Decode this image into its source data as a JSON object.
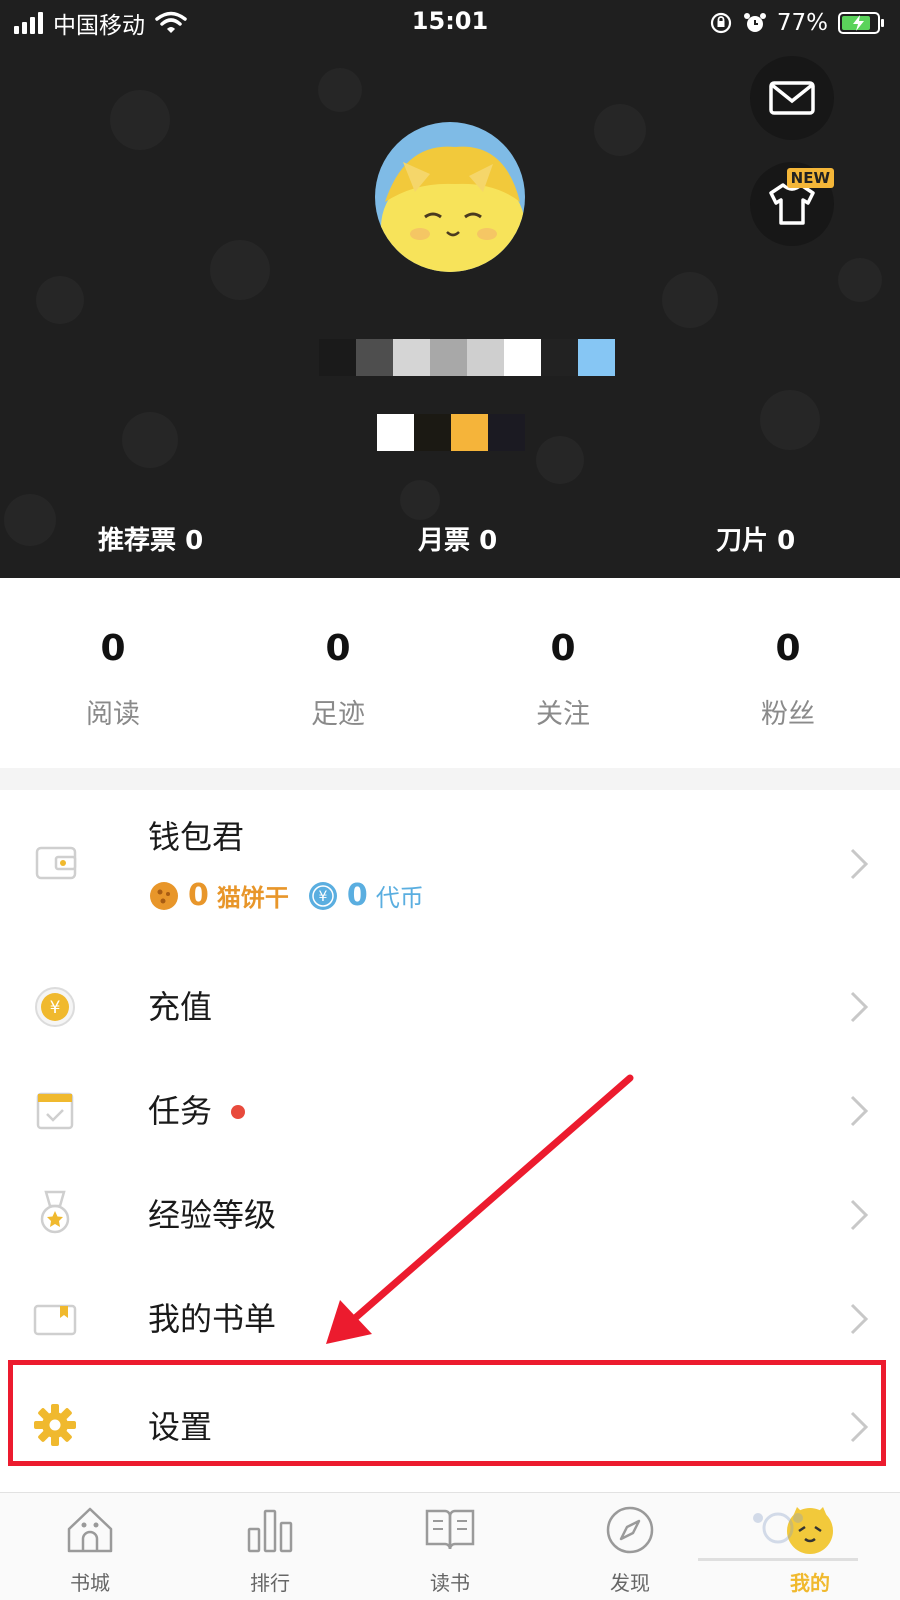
{
  "status_bar": {
    "carrier": "中国移动",
    "time": "15:01",
    "battery": "77%"
  },
  "header": {
    "new_badge": "NEW",
    "tickets": [
      {
        "label": "推荐票",
        "value": "0"
      },
      {
        "label": "月票",
        "value": "0"
      },
      {
        "label": "刀片",
        "value": "0"
      }
    ]
  },
  "stats": [
    {
      "value": "0",
      "label": "阅读"
    },
    {
      "value": "0",
      "label": "足迹"
    },
    {
      "value": "0",
      "label": "关注"
    },
    {
      "value": "0",
      "label": "粉丝"
    }
  ],
  "menu": {
    "wallet": {
      "label": "钱包君",
      "biscuit_value": "0",
      "biscuit_label": "猫饼干",
      "coin_value": "0",
      "coin_label": "代币"
    },
    "items": [
      {
        "label": "充值",
        "icon": "yuan-coin-icon"
      },
      {
        "label": "任务",
        "icon": "calendar-check-icon"
      },
      {
        "label": "经验等级",
        "icon": "medal-icon"
      },
      {
        "label": "我的书单",
        "icon": "booklist-icon"
      },
      {
        "label": "设置",
        "icon": "gear-icon"
      }
    ]
  },
  "tabbar": [
    {
      "label": "书城",
      "icon": "house-icon"
    },
    {
      "label": "排行",
      "icon": "bar-chart-icon"
    },
    {
      "label": "读书",
      "icon": "open-book-icon"
    },
    {
      "label": "发现",
      "icon": "compass-icon"
    },
    {
      "label": "我的",
      "icon": "cat-avatar-icon",
      "active": true
    }
  ],
  "colors": {
    "accent": "#F0B92E",
    "biscuit": "#E8962A",
    "coin": "#5AAEE0",
    "highlight": "#EC1B2E",
    "header_bg": "#1F1F1F"
  }
}
